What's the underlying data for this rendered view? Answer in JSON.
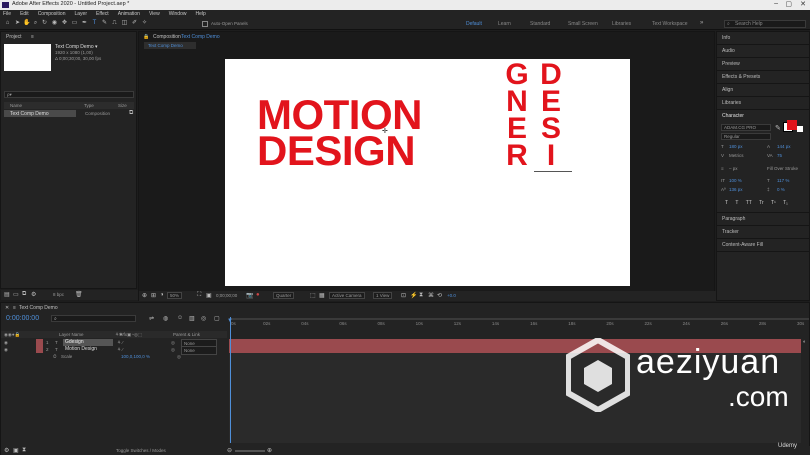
{
  "window": {
    "title": "Adobe After Effects 2020 - Untitled Project.aep *"
  },
  "menu": [
    "File",
    "Edit",
    "Composition",
    "Layer",
    "Effect",
    "Animation",
    "View",
    "Window",
    "Help"
  ],
  "toolbar": {
    "auto_open": "Auto-Open Panels",
    "workspaces": [
      "Default",
      "Learn",
      "Standard",
      "Small Screen",
      "Libraries",
      "Text Workspace"
    ],
    "active_workspace": "Default",
    "search_placeholder": "Search Help"
  },
  "project": {
    "tab": "Project",
    "comp_name": "Text Comp Demo ▾",
    "comp_size": "1920 x 1080 (1,00)",
    "comp_duration": "Δ 0;00;30;00, 30,00 fps",
    "search_placeholder": "ρ▾",
    "columns": [
      "Name",
      "Type",
      "Size"
    ],
    "rows": [
      {
        "name": "Text Comp Demo",
        "type": "Composition"
      }
    ],
    "bpc": "8 bpc"
  },
  "composition": {
    "tab_label": "Composition",
    "tab_name": "Text Comp Demo",
    "sub_tab": "Text Comp Demo",
    "motion_text": "MOTION\nDESIGN",
    "vertical_cols": [
      [
        "G",
        "N",
        "E",
        "R"
      ],
      [
        "D",
        "E",
        "S",
        "I"
      ]
    ],
    "zoom": "50%",
    "timecode": "0;00;00;00",
    "resolution": "Quarter",
    "camera": "Active Camera",
    "views": "1 View",
    "exposure": "+0.0"
  },
  "right_panels": [
    "Info",
    "Audio",
    "Preview",
    "Effects & Presets",
    "Align",
    "Libraries"
  ],
  "character": {
    "title": "Character",
    "font": "ADAM.CG PRO",
    "style": "Regular",
    "size": "180 px",
    "leading": "144 px",
    "tracking": "Metrics",
    "kerning": "75",
    "stroke": "– px",
    "stroke_type": "Fill Over Stroke",
    "vscale": "100 %",
    "hscale": "117 %",
    "baseline": "136 px",
    "tsume": "0 %",
    "styles": [
      "T",
      "T",
      "TT",
      "Tr",
      "T¹",
      "T₁"
    ]
  },
  "more_panels": [
    "Paragraph",
    "Tracker",
    "Content-Aware Fill"
  ],
  "timeline": {
    "tab": "Text Comp Demo",
    "timecode": "0:00:00:00",
    "columns": [
      "Layer Name",
      "Parent & Link"
    ],
    "layers": [
      {
        "num": "1",
        "name": "Gdesign",
        "parent": "None"
      },
      {
        "num": "2",
        "name": "Motion  Design",
        "parent": "None"
      }
    ],
    "transform": {
      "label": "Scale",
      "value": "100,0,100,0 %"
    },
    "ruler": [
      "0s",
      "02s",
      "04s",
      "06s",
      "08s",
      "10s",
      "12s",
      "14s",
      "16s",
      "18s",
      "20s",
      "22s",
      "24s",
      "26s",
      "28s",
      "30s"
    ],
    "footer": "Toggle Switches / Modes"
  },
  "watermark": {
    "line1": "aeziyuan",
    "line2": ".com",
    "udemy": "Udemy"
  },
  "colors": {
    "accent": "#4f8fd9",
    "text_red": "#e2141c",
    "layer_bar": "#9a4a4e"
  }
}
